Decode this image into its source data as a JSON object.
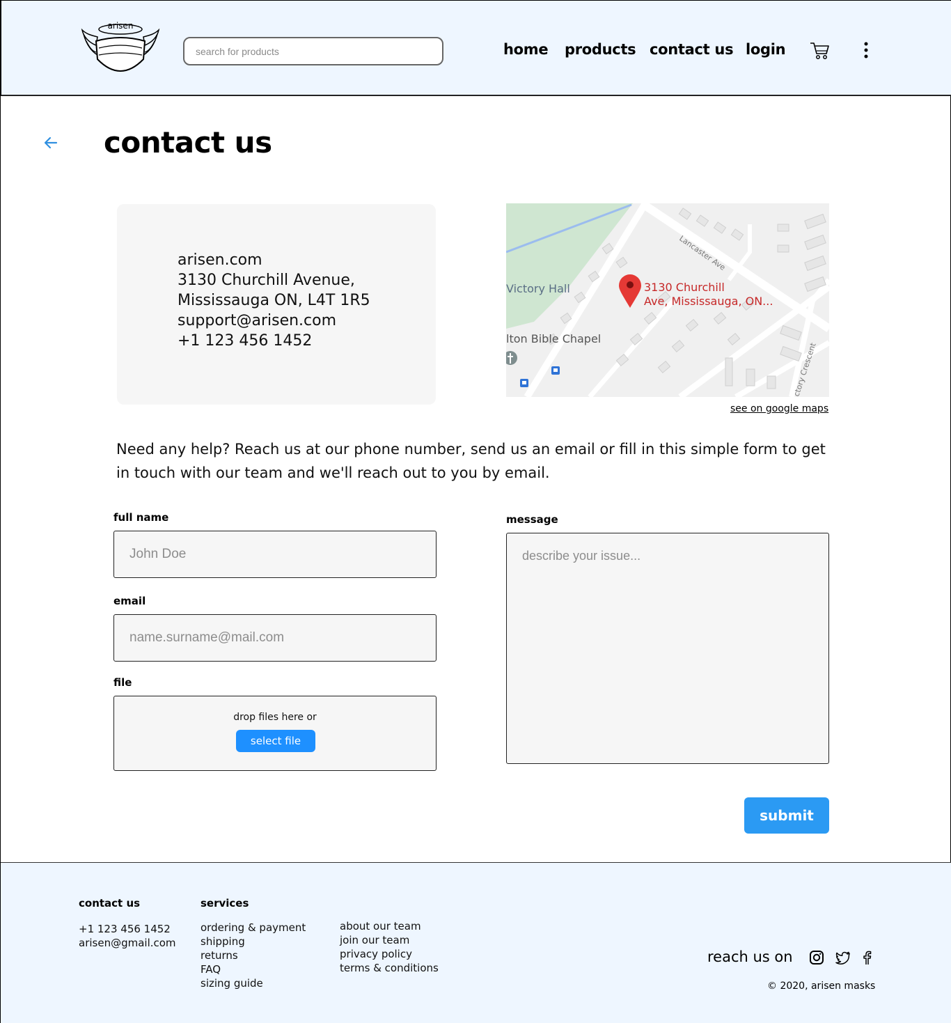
{
  "brand": {
    "logo_text": "arisen"
  },
  "search": {
    "placeholder": "search for products"
  },
  "nav": {
    "home": "home",
    "products": "products",
    "contact": "contact us",
    "login": "login"
  },
  "icons": {
    "cart": "cart-icon",
    "menu": "kebab-menu-icon",
    "back": "back-arrow-icon"
  },
  "page": {
    "title": "contact us"
  },
  "info": {
    "lines": [
      "arisen.com",
      "3130 Churchill Avenue,",
      "Mississauga ON, L4T 1R5",
      "support@arisen.com",
      "+1 123 456 1452"
    ]
  },
  "map": {
    "pin_label_1": "3130 Churchill",
    "pin_label_2": "Ave, Mississauga, ON...",
    "place_1": "Victory Hall",
    "place_2": "lton Bible Chapel",
    "street_1": "Lancaster Ave",
    "street_2": "ctory Crescent",
    "link": "see on google maps"
  },
  "help": {
    "text": "Need any help? Reach us at our phone number, send us an email or fill in this simple form to get in touch with our team and we'll reach out to you by email."
  },
  "form": {
    "full_name_label": "full name",
    "full_name_placeholder": "John Doe",
    "email_label": "email",
    "email_placeholder": "name.surname@mail.com",
    "file_label": "file",
    "drop_text": "drop files here or",
    "select_file": "select file",
    "message_label": "message",
    "message_placeholder": "describe your issue...",
    "submit": "submit"
  },
  "footer": {
    "contact_heading": "contact us",
    "phone": "+1 123 456 1452",
    "email": "arisen@gmail.com",
    "services_heading": "services",
    "services": [
      "ordering & payment",
      "shipping",
      "returns",
      "FAQ",
      "sizing guide"
    ],
    "company": [
      "about our team",
      "join our team",
      "privacy policy",
      "terms & conditions"
    ],
    "reach": "reach us on",
    "social": [
      "instagram-icon",
      "twitter-icon",
      "facebook-icon"
    ],
    "copyright": "© 2020, arisen masks"
  },
  "colors": {
    "header_bg": "#eef6ff",
    "accent_blue": "#1e90ff",
    "submit_blue": "#2b9af3",
    "map_pin": "#e53935"
  }
}
